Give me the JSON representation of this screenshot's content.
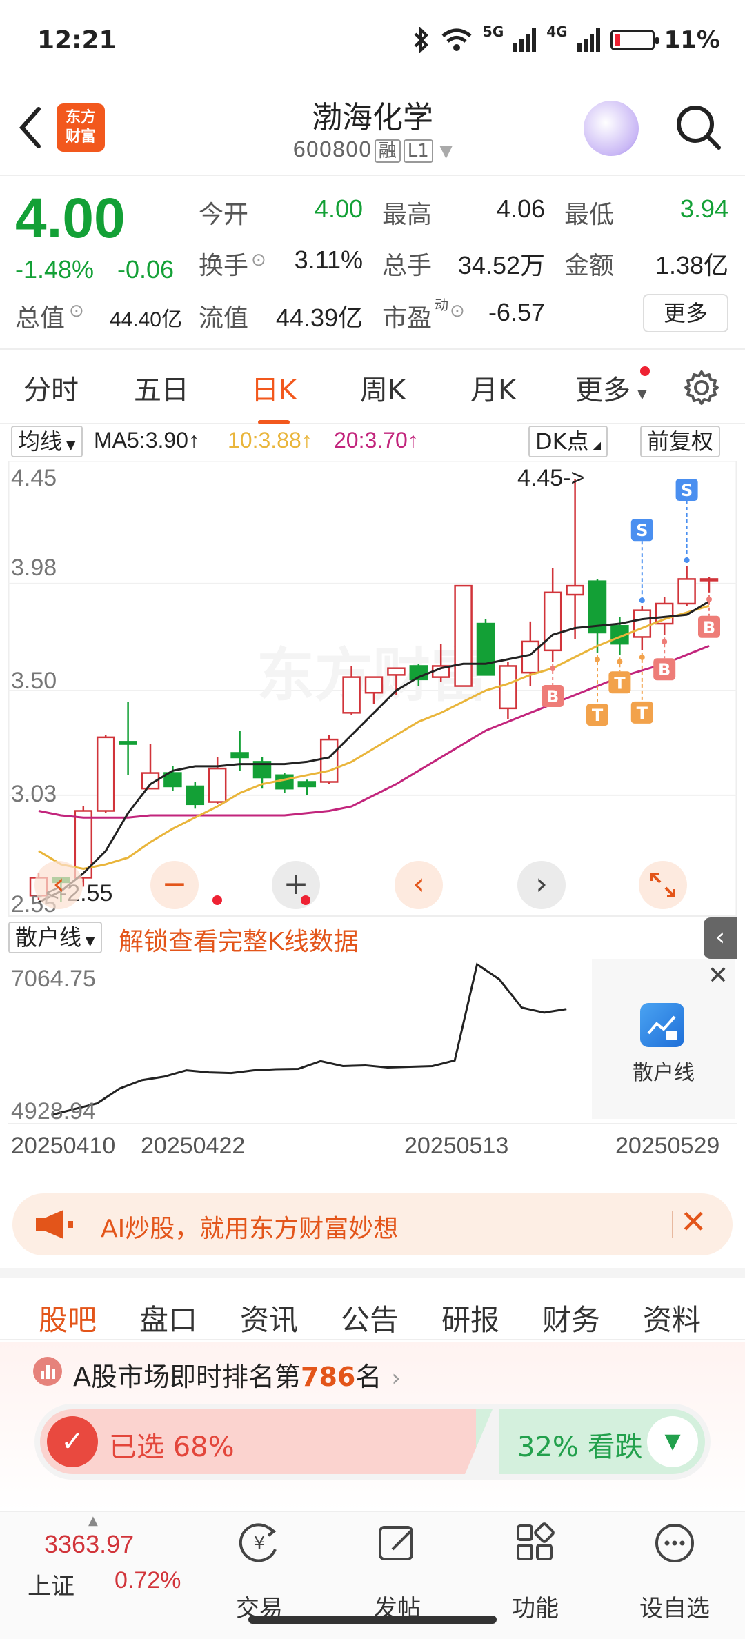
{
  "status_bar": {
    "time": "12:21",
    "signal_5g": "5G",
    "signal_4g": "4G",
    "battery": "11%"
  },
  "header": {
    "logo_line1": "东方",
    "logo_line2": "财富",
    "title": "渤海化学",
    "code": "600800",
    "tag1": "融",
    "tag2": "L1"
  },
  "quote": {
    "price": "4.00",
    "change_pct": "-1.48%",
    "change": "-0.06",
    "open_label": "今开",
    "open": "4.00",
    "high_label": "最高",
    "high": "4.06",
    "low_label": "最低",
    "low": "3.94",
    "turnover_label": "换手",
    "turnover": "3.11%",
    "volume_label": "总手",
    "volume": "34.52万",
    "amount_label": "金额",
    "amount": "1.38亿",
    "mcap_label": "总值",
    "mcap": "44.40亿",
    "float_label": "流值",
    "float": "44.39亿",
    "pe_label": "市盈",
    "pe_sup": "动",
    "pe": "-6.57",
    "more": "更多"
  },
  "tabs": [
    "分时",
    "五日",
    "日K",
    "周K",
    "月K",
    "更多"
  ],
  "chart_toolbar": {
    "ma_select": "均线",
    "ma5": "MA5:3.90↑",
    "ma10": "10:3.88↑",
    "ma20": "20:3.70↑",
    "dk": "DK点",
    "adjust": "前复权",
    "ma5_color": "#222222",
    "ma10_color": "#e9b53b",
    "ma20_color": "#c2257c"
  },
  "chart_data": {
    "type": "candlestick",
    "ylim": [
      2.55,
      4.45
    ],
    "y_ticks": [
      "4.45",
      "3.98",
      "3.50",
      "3.03",
      "2.55"
    ],
    "max_annotation": "4.45->",
    "min_annotation": "<-2.55",
    "up_color": "#d1343a",
    "down_color": "#13a036",
    "candles": [
      {
        "o": 2.58,
        "c": 2.66,
        "h": 2.68,
        "l": 2.56
      },
      {
        "o": 2.66,
        "c": 2.64,
        "h": 2.66,
        "l": 2.55
      },
      {
        "o": 2.66,
        "c": 2.96,
        "h": 2.98,
        "l": 2.62
      },
      {
        "o": 2.96,
        "c": 3.29,
        "h": 3.3,
        "l": 2.95
      },
      {
        "o": 3.27,
        "c": 3.26,
        "h": 3.45,
        "l": 3.12
      },
      {
        "o": 3.06,
        "c": 3.13,
        "h": 3.26,
        "l": 3.06
      },
      {
        "o": 3.13,
        "c": 3.07,
        "h": 3.16,
        "l": 3.05
      },
      {
        "o": 3.07,
        "c": 2.99,
        "h": 3.09,
        "l": 2.97
      },
      {
        "o": 3.0,
        "c": 3.15,
        "h": 3.2,
        "l": 2.99
      },
      {
        "o": 3.22,
        "c": 3.2,
        "h": 3.32,
        "l": 3.14
      },
      {
        "o": 3.18,
        "c": 3.11,
        "h": 3.2,
        "l": 3.06
      },
      {
        "o": 3.12,
        "c": 3.06,
        "h": 3.13,
        "l": 3.04
      },
      {
        "o": 3.09,
        "c": 3.07,
        "h": 3.1,
        "l": 3.03
      },
      {
        "o": 3.09,
        "c": 3.28,
        "h": 3.3,
        "l": 3.08
      },
      {
        "o": 3.4,
        "c": 3.56,
        "h": 3.61,
        "l": 3.39
      },
      {
        "o": 3.49,
        "c": 3.56,
        "h": 3.56,
        "l": 3.44
      },
      {
        "o": 3.57,
        "c": 3.6,
        "h": 3.6,
        "l": 3.48
      },
      {
        "o": 3.61,
        "c": 3.55,
        "h": 3.62,
        "l": 3.52
      },
      {
        "o": 3.56,
        "c": 3.61,
        "h": 3.71,
        "l": 3.54
      },
      {
        "o": 3.52,
        "c": 3.97,
        "h": 3.97,
        "l": 3.52
      },
      {
        "o": 3.8,
        "c": 3.57,
        "h": 3.82,
        "l": 3.57
      },
      {
        "o": 3.42,
        "c": 3.61,
        "h": 3.63,
        "l": 3.37
      },
      {
        "o": 3.58,
        "c": 3.72,
        "h": 3.81,
        "l": 3.52
      },
      {
        "o": 3.68,
        "c": 3.94,
        "h": 4.05,
        "l": 3.63
      },
      {
        "o": 3.93,
        "c": 3.97,
        "h": 4.45,
        "l": 3.73
      },
      {
        "o": 3.99,
        "c": 3.76,
        "h": 4.0,
        "l": 3.67
      },
      {
        "o": 3.79,
        "c": 3.71,
        "h": 3.83,
        "l": 3.66
      },
      {
        "o": 3.74,
        "c": 3.86,
        "h": 3.88,
        "l": 3.68
      },
      {
        "o": 3.8,
        "c": 3.89,
        "h": 3.92,
        "l": 3.75
      },
      {
        "o": 3.89,
        "c": 4.0,
        "h": 4.06,
        "l": 3.88
      },
      {
        "o": 4.0,
        "c": 4.0,
        "h": 4.01,
        "l": 3.94
      }
    ],
    "ma5": [
      2.55,
      2.6,
      2.68,
      2.78,
      2.95,
      3.08,
      3.14,
      3.16,
      3.16,
      3.17,
      3.17,
      3.17,
      3.18,
      3.2,
      3.3,
      3.4,
      3.5,
      3.56,
      3.6,
      3.62,
      3.62,
      3.64,
      3.66,
      3.75,
      3.78,
      3.79,
      3.8,
      3.82,
      3.83,
      3.84,
      3.9
    ],
    "ma10": [
      2.78,
      2.72,
      2.7,
      2.72,
      2.75,
      2.82,
      2.88,
      2.93,
      2.98,
      3.04,
      3.08,
      3.1,
      3.12,
      3.14,
      3.18,
      3.24,
      3.3,
      3.36,
      3.4,
      3.45,
      3.5,
      3.53,
      3.57,
      3.6,
      3.65,
      3.7,
      3.74,
      3.78,
      3.82,
      3.85,
      3.88
    ],
    "ma20": [
      2.96,
      2.94,
      2.93,
      2.93,
      2.93,
      2.94,
      2.94,
      2.94,
      2.94,
      2.94,
      2.94,
      2.94,
      2.95,
      2.96,
      2.98,
      3.03,
      3.08,
      3.14,
      3.2,
      3.26,
      3.32,
      3.36,
      3.4,
      3.44,
      3.48,
      3.52,
      3.56,
      3.59,
      3.62,
      3.66,
      3.7
    ],
    "markers": [
      {
        "i": 23,
        "label": "B",
        "side": "below"
      },
      {
        "i": 25,
        "label": "T",
        "side": "below"
      },
      {
        "i": 26,
        "label": "T",
        "side": "below"
      },
      {
        "i": 27,
        "label": "T",
        "side": "below"
      },
      {
        "i": 28,
        "label": "B",
        "side": "below"
      },
      {
        "i": 30,
        "label": "B",
        "side": "below"
      },
      {
        "i": 27,
        "label": "S",
        "side": "above"
      },
      {
        "i": 29,
        "label": "S",
        "side": "above"
      }
    ]
  },
  "chart_controls": {
    "minus": "−",
    "plus": "+",
    "prev": "‹",
    "next": "›"
  },
  "indicator": {
    "select": "散户线",
    "unlock_text": "解锁查看完整K线数据",
    "y_max": "7064.75",
    "y_min": "4928.94",
    "card_label": "散户线",
    "values": [
      4928.94,
      5010,
      5090,
      5300,
      5420,
      5470,
      5560,
      5530,
      5520,
      5560,
      5575,
      5580,
      5690,
      5620,
      5630,
      5600,
      5610,
      5620,
      5700,
      7064.75,
      6850,
      6450,
      6380,
      6430
    ]
  },
  "dates": [
    "20250410",
    "20250422",
    "20250513",
    "20250529"
  ],
  "banner": {
    "text": "AI炒股，就用东方财富妙想"
  },
  "subtabs": [
    "股吧",
    "盘口",
    "资讯",
    "公告",
    "研报",
    "财务",
    "资料"
  ],
  "rank": {
    "prefix": "A股市场即时排名第",
    "number": "786",
    "suffix": "名"
  },
  "vote": {
    "selected": "已选 68%",
    "down": "32% 看跌"
  },
  "bottom": {
    "index_value": "3363.97",
    "index_name": "上证",
    "index_change": "0.72%",
    "items": [
      "交易",
      "发帖",
      "功能",
      "设自选"
    ]
  }
}
